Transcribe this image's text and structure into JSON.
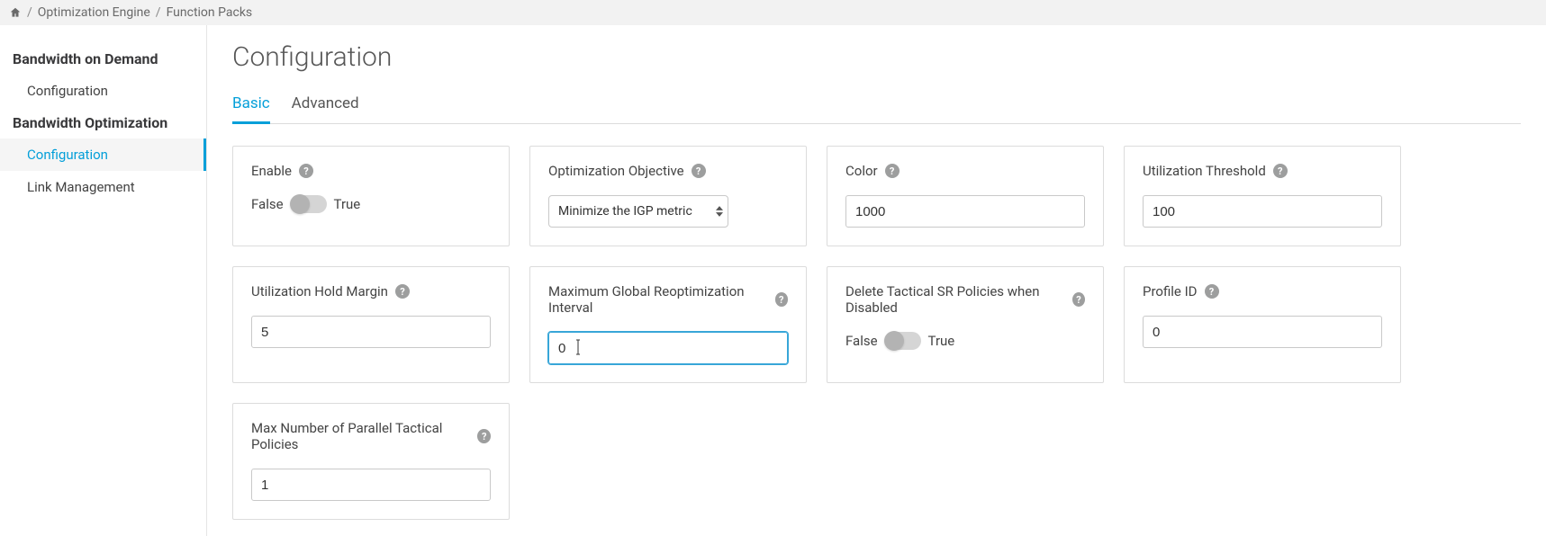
{
  "breadcrumb": {
    "segments": [
      "Optimization Engine",
      "Function Packs"
    ]
  },
  "sidebar": {
    "groups": [
      {
        "title": "Bandwidth on Demand",
        "items": [
          {
            "label": "Configuration",
            "active": false
          }
        ]
      },
      {
        "title": "Bandwidth Optimization",
        "items": [
          {
            "label": "Configuration",
            "active": true
          },
          {
            "label": "Link Management",
            "active": false
          }
        ]
      }
    ]
  },
  "page": {
    "title": "Configuration"
  },
  "tabs": [
    {
      "label": "Basic",
      "active": true
    },
    {
      "label": "Advanced",
      "active": false
    }
  ],
  "cards": {
    "enable": {
      "label": "Enable",
      "false_label": "False",
      "true_label": "True",
      "value": false
    },
    "optimization_objective": {
      "label": "Optimization Objective",
      "selected": "Minimize the IGP metric"
    },
    "color": {
      "label": "Color",
      "value": "1000"
    },
    "utilization_threshold": {
      "label": "Utilization Threshold",
      "value": "100"
    },
    "utilization_hold_margin": {
      "label": "Utilization Hold Margin",
      "value": "5"
    },
    "max_global_reopt_interval": {
      "label": "Maximum Global Reoptimization Interval",
      "value": "0"
    },
    "delete_tactical": {
      "label": "Delete Tactical SR Policies when Disabled",
      "false_label": "False",
      "true_label": "True",
      "value": false
    },
    "profile_id": {
      "label": "Profile ID",
      "value": "0"
    },
    "max_parallel_tactical": {
      "label": "Max Number of Parallel Tactical Policies",
      "value": "1"
    }
  }
}
